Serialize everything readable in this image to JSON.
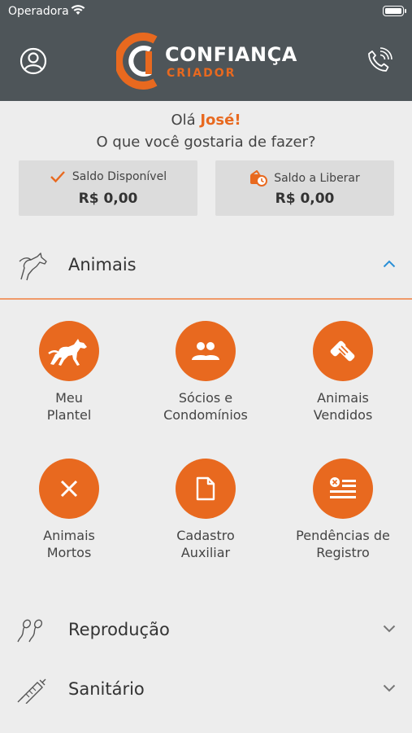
{
  "status_bar": {
    "carrier": "Operadora"
  },
  "header": {
    "logo_line1": "CONFIANÇA",
    "logo_line2": "CRIADOR"
  },
  "greeting": {
    "prefix": "Olá ",
    "name": "José!",
    "question": "O que você gostaria de fazer?"
  },
  "balances": [
    {
      "label": "Saldo Disponível",
      "value": "R$ 0,00"
    },
    {
      "label": "Saldo a Liberar",
      "value": "R$ 0,00"
    }
  ],
  "sections": {
    "animais": {
      "label": "Animais",
      "expanded": true,
      "tiles": [
        {
          "label": "Meu\nPlantel",
          "icon": "horse-icon"
        },
        {
          "label": "Sócios e\nCondomínios",
          "icon": "people-icon"
        },
        {
          "label": "Animais\nVendidos",
          "icon": "handshake-icon"
        },
        {
          "label": "Animais\nMortos",
          "icon": "close-icon"
        },
        {
          "label": "Cadastro\nAuxiliar",
          "icon": "document-icon"
        },
        {
          "label": "Pendências de\nRegistro",
          "icon": "form-icon"
        }
      ]
    },
    "reproducao": {
      "label": "Reprodução",
      "expanded": false
    },
    "sanitario": {
      "label": "Sanitário",
      "expanded": false
    }
  },
  "colors": {
    "accent": "#e8691f",
    "header": "#4e5559",
    "background": "#ededed",
    "card": "#dcdcdc"
  }
}
